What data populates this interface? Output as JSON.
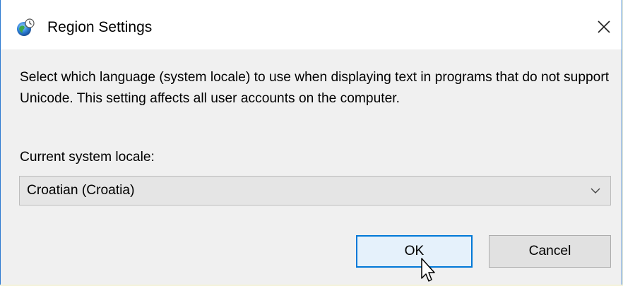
{
  "window": {
    "title": "Region Settings",
    "icon": "globe-clock-icon",
    "close_glyph": "✕"
  },
  "description": "Select which language (system locale) to use when displaying text in programs that do not support Unicode. This setting affects all user accounts on the computer.",
  "locale": {
    "label": "Current system locale:",
    "selected": "Croatian (Croatia)"
  },
  "buttons": {
    "ok_label": "OK",
    "cancel_label": "Cancel"
  },
  "colors": {
    "accent": "#0078d7",
    "window_border": "#2b79d0",
    "dialog_background": "#f0f0f0",
    "titlebar_background": "#ffffff"
  }
}
